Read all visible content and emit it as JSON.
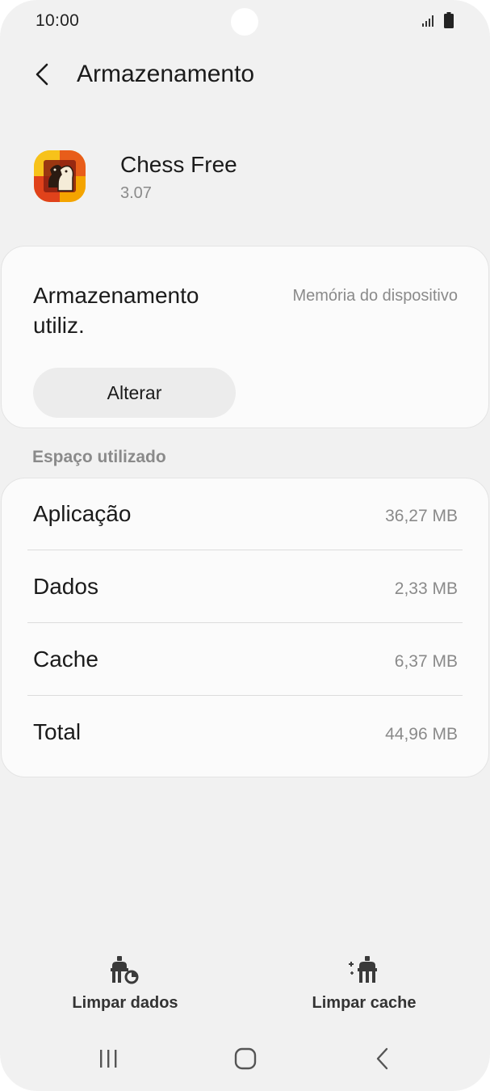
{
  "status_bar": {
    "time": "10:00",
    "icons": [
      "signal-icon",
      "battery-icon"
    ]
  },
  "header": {
    "title": "Armazenamento",
    "back_icon": "chevron-left-icon"
  },
  "app": {
    "name": "Chess Free",
    "version": "3.07",
    "icon": "chess-knight-icon"
  },
  "storage": {
    "label": "Armazenamento utiliz.",
    "location": "Memória do dispositivo",
    "change_button": "Alterar"
  },
  "usage": {
    "section_title": "Espaço utilizado",
    "rows": [
      {
        "label": "Aplicação",
        "value": "36,27 MB"
      },
      {
        "label": "Dados",
        "value": "2,33 MB"
      },
      {
        "label": "Cache",
        "value": "6,37 MB"
      },
      {
        "label": "Total",
        "value": "44,96 MB"
      }
    ]
  },
  "actions": {
    "clear_data": "Limpar dados",
    "clear_cache": "Limpar cache"
  },
  "nav": {
    "icons": [
      "recents-icon",
      "home-icon",
      "back-icon"
    ]
  },
  "colors": {
    "background": "#f1f1f1",
    "card": "#fbfbfb",
    "text_primary": "#1b1b1b",
    "text_secondary": "#8a8a8a"
  }
}
